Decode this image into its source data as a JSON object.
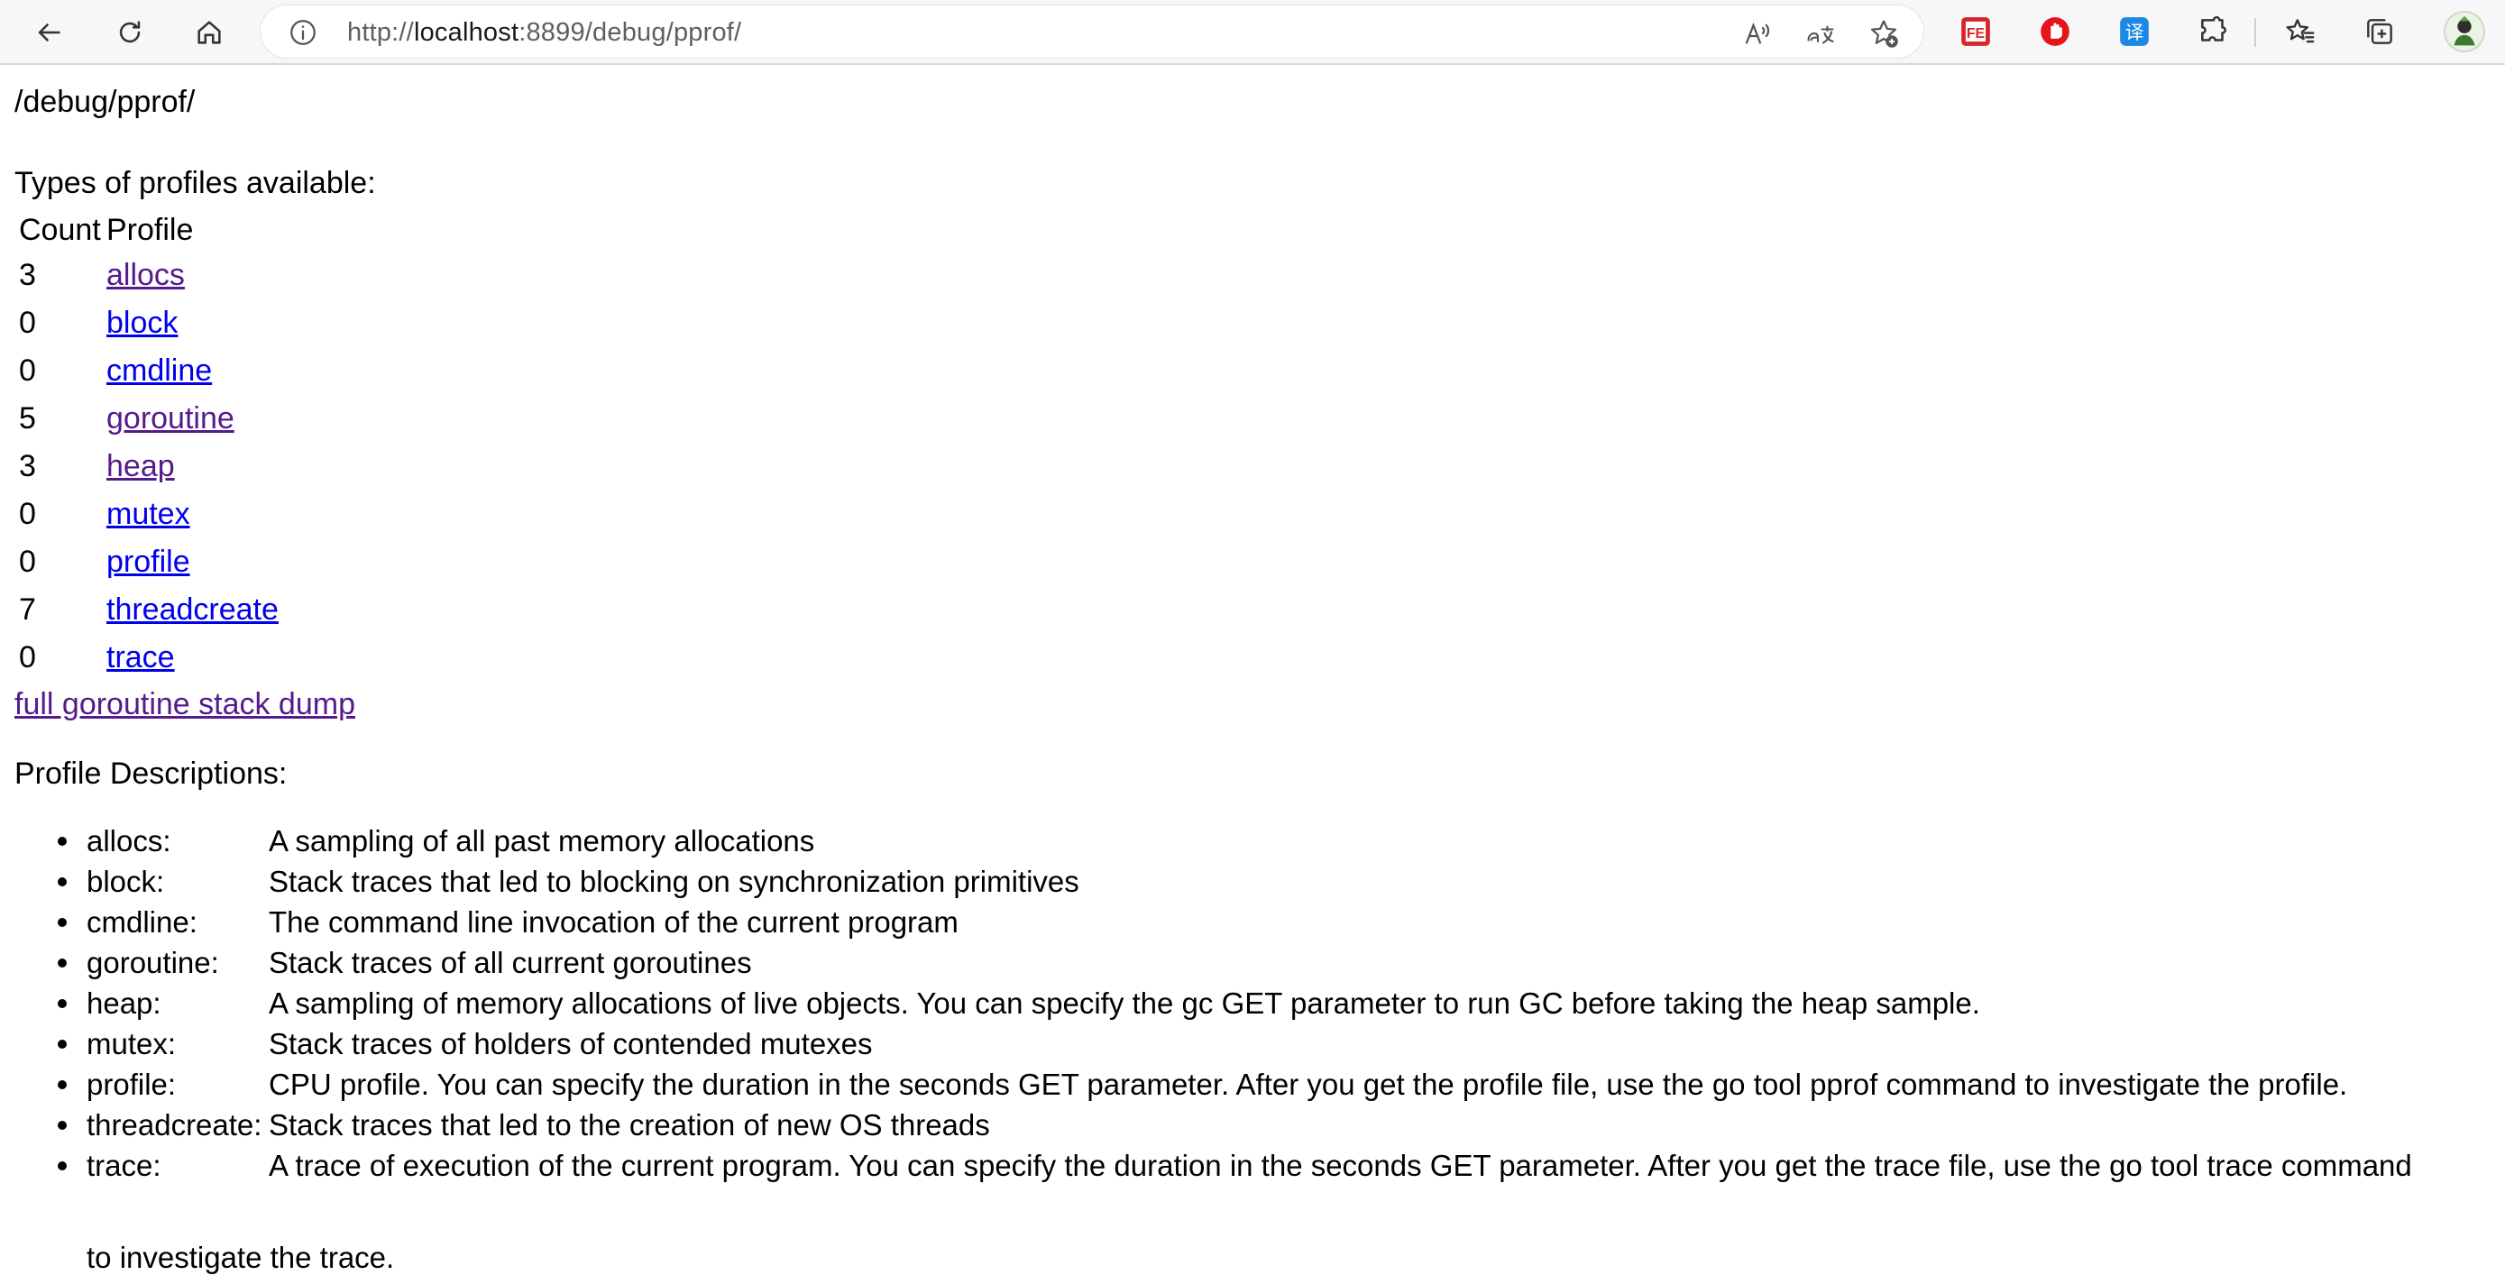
{
  "browser": {
    "url_prefix": "http://",
    "url_host": "localhost",
    "url_rest": ":8899/debug/pprof/",
    "icons": {
      "back": "back-arrow-icon",
      "refresh": "refresh-icon",
      "home": "home-icon",
      "site_info": "info-icon",
      "read_aloud": "read-aloud-icon",
      "translate": "translate-icon",
      "favorite_add": "add-favorite-icon",
      "ext1": "fe-extension-icon",
      "ext2": "adblock-extension-icon",
      "ext3": "translate-extension-icon",
      "extensions": "puzzle-icon",
      "favorites": "favorites-icon",
      "collections": "collections-icon",
      "profile": "avatar"
    },
    "ext1_label": "FE",
    "ext3_label": "译"
  },
  "page": {
    "path_heading": "/debug/pprof/",
    "types_title": "Types of profiles available:",
    "table": {
      "headers": [
        "Count",
        "Profile"
      ],
      "rows": [
        {
          "count": "3",
          "profile": "allocs"
        },
        {
          "count": "0",
          "profile": "block"
        },
        {
          "count": "0",
          "profile": "cmdline"
        },
        {
          "count": "5",
          "profile": "goroutine"
        },
        {
          "count": "3",
          "profile": "heap"
        },
        {
          "count": "0",
          "profile": "mutex"
        },
        {
          "count": "0",
          "profile": "profile"
        },
        {
          "count": "7",
          "profile": "threadcreate"
        },
        {
          "count": "0",
          "profile": "trace"
        }
      ]
    },
    "full_dump_link": "full goroutine stack dump",
    "descriptions_title": "Profile Descriptions:",
    "descriptions": [
      {
        "name": "allocs:",
        "text": "A sampling of all past memory allocations"
      },
      {
        "name": "block:",
        "text": "Stack traces that led to blocking on synchronization primitives"
      },
      {
        "name": "cmdline:",
        "text": "The command line invocation of the current program"
      },
      {
        "name": "goroutine:",
        "text": "Stack traces of all current goroutines"
      },
      {
        "name": "heap:",
        "text": "A sampling of memory allocations of live objects. You can specify the gc GET parameter to run GC before taking the heap sample."
      },
      {
        "name": "mutex:",
        "text": "Stack traces of holders of contended mutexes"
      },
      {
        "name": "profile:",
        "text": "CPU profile. You can specify the duration in the seconds GET parameter. After you get the profile file, use the go tool pprof command to investigate the profile."
      },
      {
        "name": "threadcreate:",
        "text": "Stack traces that led to the creation of new OS threads"
      },
      {
        "name": "trace:",
        "text": "A trace of execution of the current program. You can specify the duration in the seconds GET parameter. After you get the trace file, use the go tool trace command"
      }
    ],
    "trace_continuation": "to investigate the trace."
  }
}
